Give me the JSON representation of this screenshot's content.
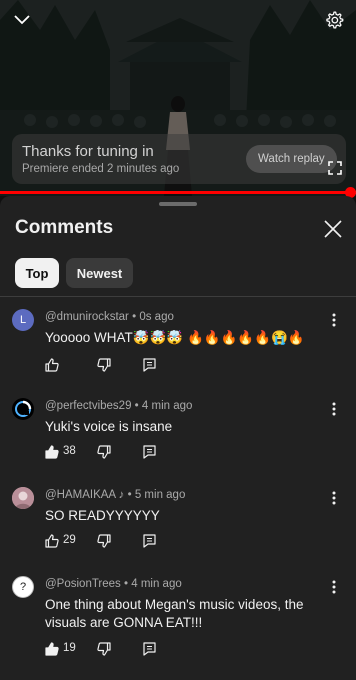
{
  "player": {
    "premiere_title": "Thanks for tuning in",
    "premiere_subtitle": "Premiere ended 2 minutes ago",
    "watch_replay_label": "Watch replay",
    "progress": 0.985,
    "accent_color": "#ff0000"
  },
  "icons": {
    "collapse": "chevron-down-icon",
    "settings": "gear-icon",
    "fullscreen": "fullscreen-icon",
    "close": "close-icon",
    "like": "thumbs-up-icon",
    "dislike": "thumbs-down-icon",
    "reply": "reply-icon",
    "more": "more-vertical-icon"
  },
  "comments_panel": {
    "title": "Comments",
    "filters": [
      "Top",
      "Newest"
    ],
    "selected_filter": "Top"
  },
  "comments": [
    {
      "author": "@dmunirockstar",
      "time": "0s ago",
      "text": "Yooooo WHAT🤯🤯🤯 🔥🔥🔥🔥🔥😭🔥",
      "likes": "",
      "liked": false,
      "avatar_letter": "L",
      "avatar_color": "#5c6bc0"
    },
    {
      "author": "@perfectvibes29",
      "time": "4 min ago",
      "text": "Yuki's voice is insane",
      "likes": "38",
      "liked": true,
      "avatar_letter": "",
      "avatar_color": "#000000"
    },
    {
      "author": "@HAMAIKAA ♪",
      "time": "5 min ago",
      "text": "SO READYYYYYY",
      "likes": "29",
      "liked": false,
      "avatar_letter": "",
      "avatar_color": "#c9a0a8"
    },
    {
      "author": "@PosionTrees",
      "time": "4 min ago",
      "text": "One thing about Megan's music videos, the visuals are GONNA EAT!!!",
      "likes": "19",
      "liked": true,
      "avatar_letter": "?",
      "avatar_color": "#ffffff"
    }
  ]
}
